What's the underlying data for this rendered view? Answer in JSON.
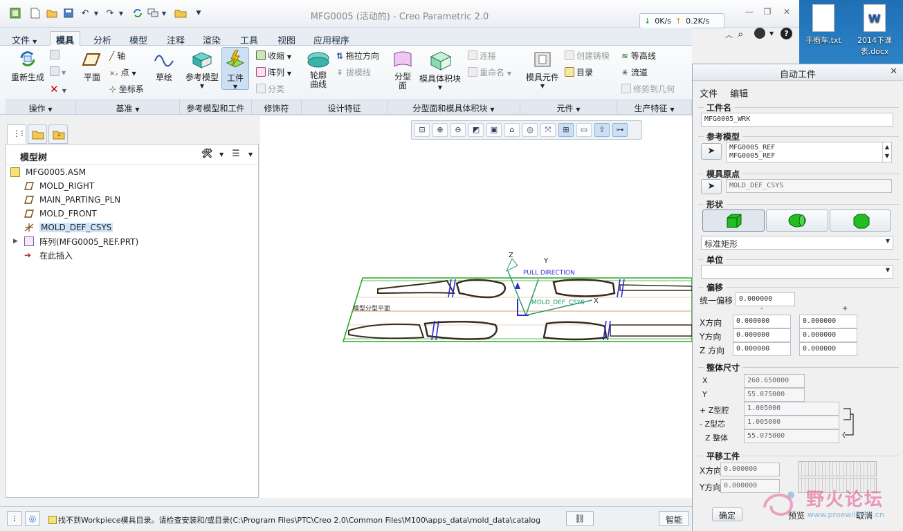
{
  "window": {
    "title": "MFG0005 (活动的) - Creo Parametric 2.0",
    "net_down": "0K/s",
    "net_up": "0.2K/s"
  },
  "desktop": {
    "icon1_label": "手衝车.txt",
    "icon2_label": "2014下课表.docx"
  },
  "ribbon": {
    "tabs": [
      "文件",
      "模具",
      "分析",
      "模型",
      "注释",
      "渲染",
      "工具",
      "视图",
      "应用程序"
    ],
    "active_tab": "模具",
    "buttons": {
      "regenerate": "重新生成",
      "plane": "平面",
      "axis": "轴",
      "point": "点",
      "csys": "坐标系",
      "sketch": "草绘",
      "ref_model": "参考模型",
      "workpiece": "工件",
      "shrink": "收缩",
      "pattern": "阵列",
      "classify": "分类",
      "silhouette": "轮廓曲线",
      "pull_direction": "拖拉方向",
      "draft_line": "拔模线",
      "parting_surface": "分型面",
      "mold_volume": "模具体积块",
      "connect": "连接",
      "rename": "重命名",
      "mold_component": "模具元件",
      "create_casting": "创建铸模",
      "directory": "目录",
      "contour": "等高线",
      "runner": "流道",
      "trim_geometry": "修剪到几何"
    },
    "groups": [
      "操作",
      "基准",
      "参考模型和工件",
      "修饰符",
      "设计特征",
      "分型面和模具体积块",
      "元件",
      "生产特征"
    ]
  },
  "model_tree": {
    "header": "模型树",
    "items": [
      {
        "label": "MFG0005.ASM"
      },
      {
        "label": "MOLD_RIGHT"
      },
      {
        "label": "MAIN_PARTING_PLN"
      },
      {
        "label": "MOLD_FRONT"
      },
      {
        "label": "MOLD_DEF_CSYS"
      },
      {
        "label": "阵列(MFG0005_REF.PRT)"
      },
      {
        "label": "在此插入"
      }
    ]
  },
  "graphics": {
    "label_z": "Z",
    "label_y": "Y",
    "label_x": "X",
    "pull_direction": "PULL DIRECTION",
    "csys_label": "MOLD_DEF_CSYS",
    "plane_label": "模型分型平面"
  },
  "dialog": {
    "title": "自动工件",
    "menu_file": "文件",
    "menu_edit": "编辑",
    "workpiece_name_label": "工件名",
    "workpiece_name": "MFG0005_WRK",
    "ref_model_label": "参考模型",
    "ref_model_1": "MFG0005_REF",
    "ref_model_2": "MFG0005_REF",
    "origin_label": "模具原点",
    "origin_value": "MOLD_DEF_CSYS",
    "shape_label": "形状",
    "shape_select": "标准矩形",
    "unit_label": "单位",
    "unit_select": "",
    "offset_label": "偏移",
    "uniform_offset_label": "统一偏移",
    "uniform_offset": "0.000000",
    "minus": "-",
    "plus": "+",
    "x_dir": "X方向",
    "y_dir": "Y方向",
    "z_dir": "Z 方向",
    "x_minus": "0.000000",
    "x_plus": "0.000000",
    "y_minus": "0.000000",
    "y_plus": "0.000000",
    "z_minus": "0.000000",
    "z_plus": "0.000000",
    "overall_label": "整体尺寸",
    "dim_x_label": "X",
    "dim_x": "260.650000",
    "dim_y_label": "Y",
    "dim_y": "55.075000",
    "cavity_label": "+ Z型腔",
    "cavity": "1.005000",
    "core_label": "- Z型芯",
    "core": "1.005000",
    "z_total_label": "Z 整体",
    "z_total": "55.075000",
    "translate_label": "平移工件",
    "tx_label": "X方向",
    "tx": "0.000000",
    "ty_label": "Y方向",
    "ty": "0.000000",
    "ok": "确定",
    "preview": "预览",
    "cancel": "取消"
  },
  "status": {
    "message": "找不到Workpiece模具目录。请检查安装和/或目录(C:\\Program Files\\PTC\\Creo 2.0\\Common Files\\M100\\apps_data\\mold_data\\catalog",
    "smart": "智能"
  },
  "watermark": {
    "title": "野火论坛",
    "url": "www.proewildfire.cn"
  },
  "colors": {
    "accent": "#2d83c7",
    "workpiece_green": "#2aa62a",
    "part_outline": "#3a2a1a",
    "highlight": "#cde5fb"
  }
}
